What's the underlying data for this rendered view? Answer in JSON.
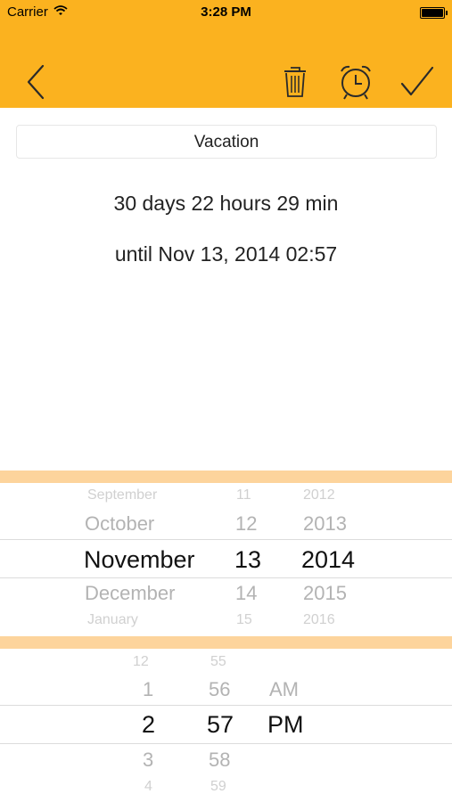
{
  "status_bar": {
    "carrier": "Carrier",
    "time": "3:28 PM"
  },
  "nav": {
    "back_icon": "chevron-left-icon",
    "delete_icon": "trash-icon",
    "alarm_icon": "alarm-clock-icon",
    "confirm_icon": "checkmark-icon"
  },
  "event": {
    "name": "Vacation",
    "countdown": "30 days 22 hours 29 min",
    "until": "until Nov 13, 2014 02:57"
  },
  "date_picker": {
    "months": [
      "September",
      "October",
      "November",
      "December",
      "January"
    ],
    "days": [
      "11",
      "12",
      "13",
      "14",
      "15"
    ],
    "years": [
      "2012",
      "2013",
      "2014",
      "2015",
      "2016"
    ]
  },
  "time_picker": {
    "hours": [
      "12",
      "1",
      "2",
      "3",
      "4"
    ],
    "minutes": [
      "55",
      "56",
      "57",
      "58",
      "59"
    ],
    "ampm": [
      "AM",
      "PM"
    ]
  },
  "colors": {
    "header": "#fbb21f",
    "picker_divider": "#fdd49c"
  }
}
